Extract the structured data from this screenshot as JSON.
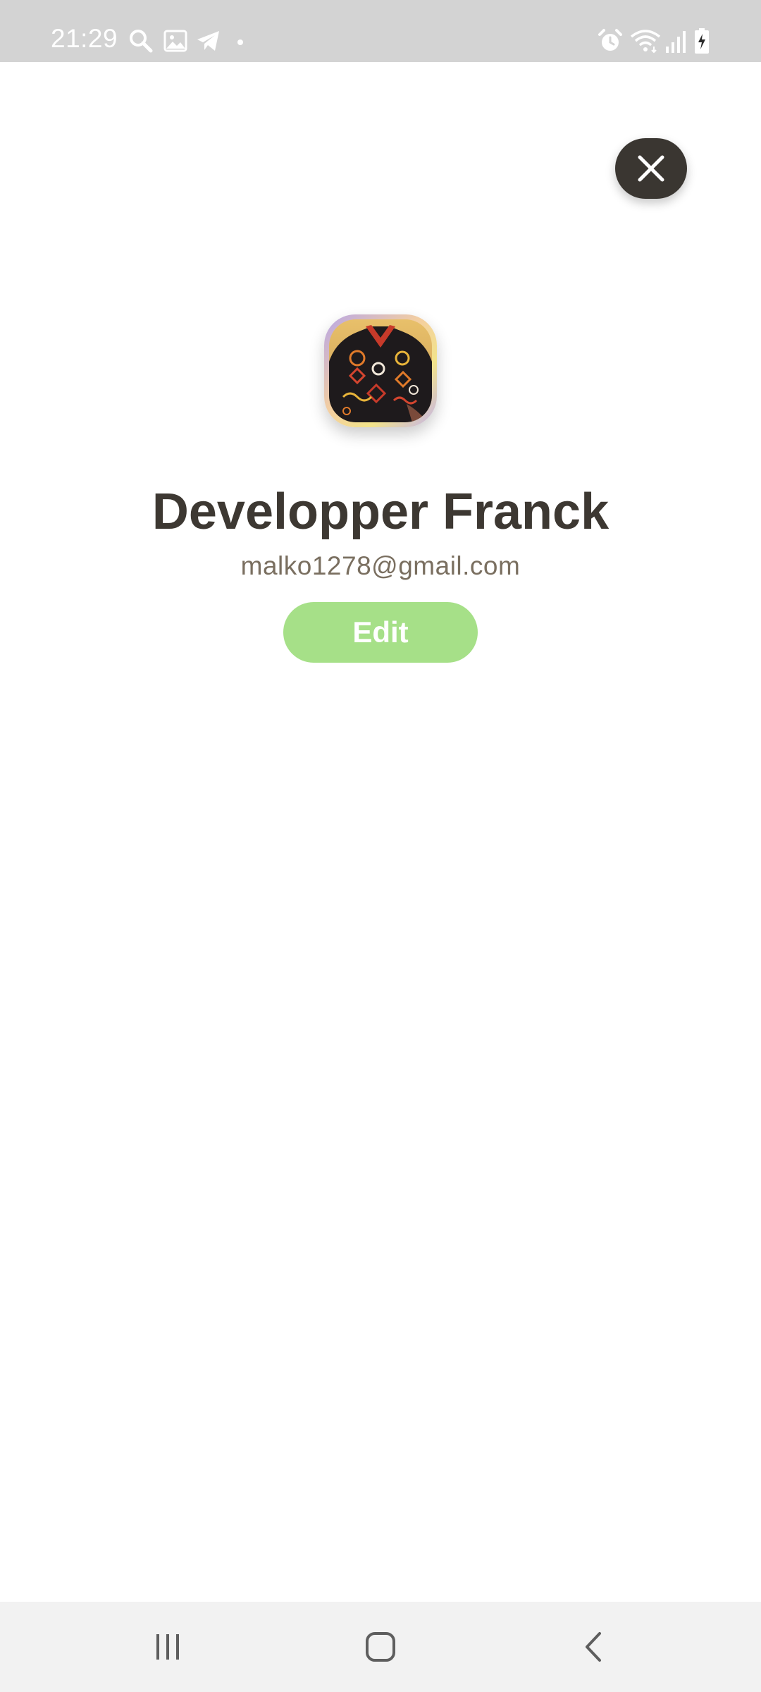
{
  "status_bar": {
    "time": "21:29",
    "left_icons": [
      "search-icon",
      "image-icon",
      "telegram-icon",
      "dot-icon"
    ],
    "right_icons": [
      "alarm-icon",
      "wifi-icon",
      "signal-icon",
      "battery-charging-icon"
    ]
  },
  "profile": {
    "name": "Developper Franck",
    "email": "malko1278@gmail.com",
    "edit_label": "Edit"
  },
  "close_button": {
    "icon": "close-icon"
  },
  "nav_bar": {
    "buttons": [
      "recent-apps-icon",
      "home-icon",
      "back-icon"
    ]
  },
  "colors": {
    "status_bar_bg": "#d3d3d3",
    "close_button_bg": "#3a3631",
    "name_text": "#3d3832",
    "email_text": "#7a6f60",
    "edit_button_bg": "#a6e088",
    "nav_bar_bg": "#f2f2f2"
  }
}
